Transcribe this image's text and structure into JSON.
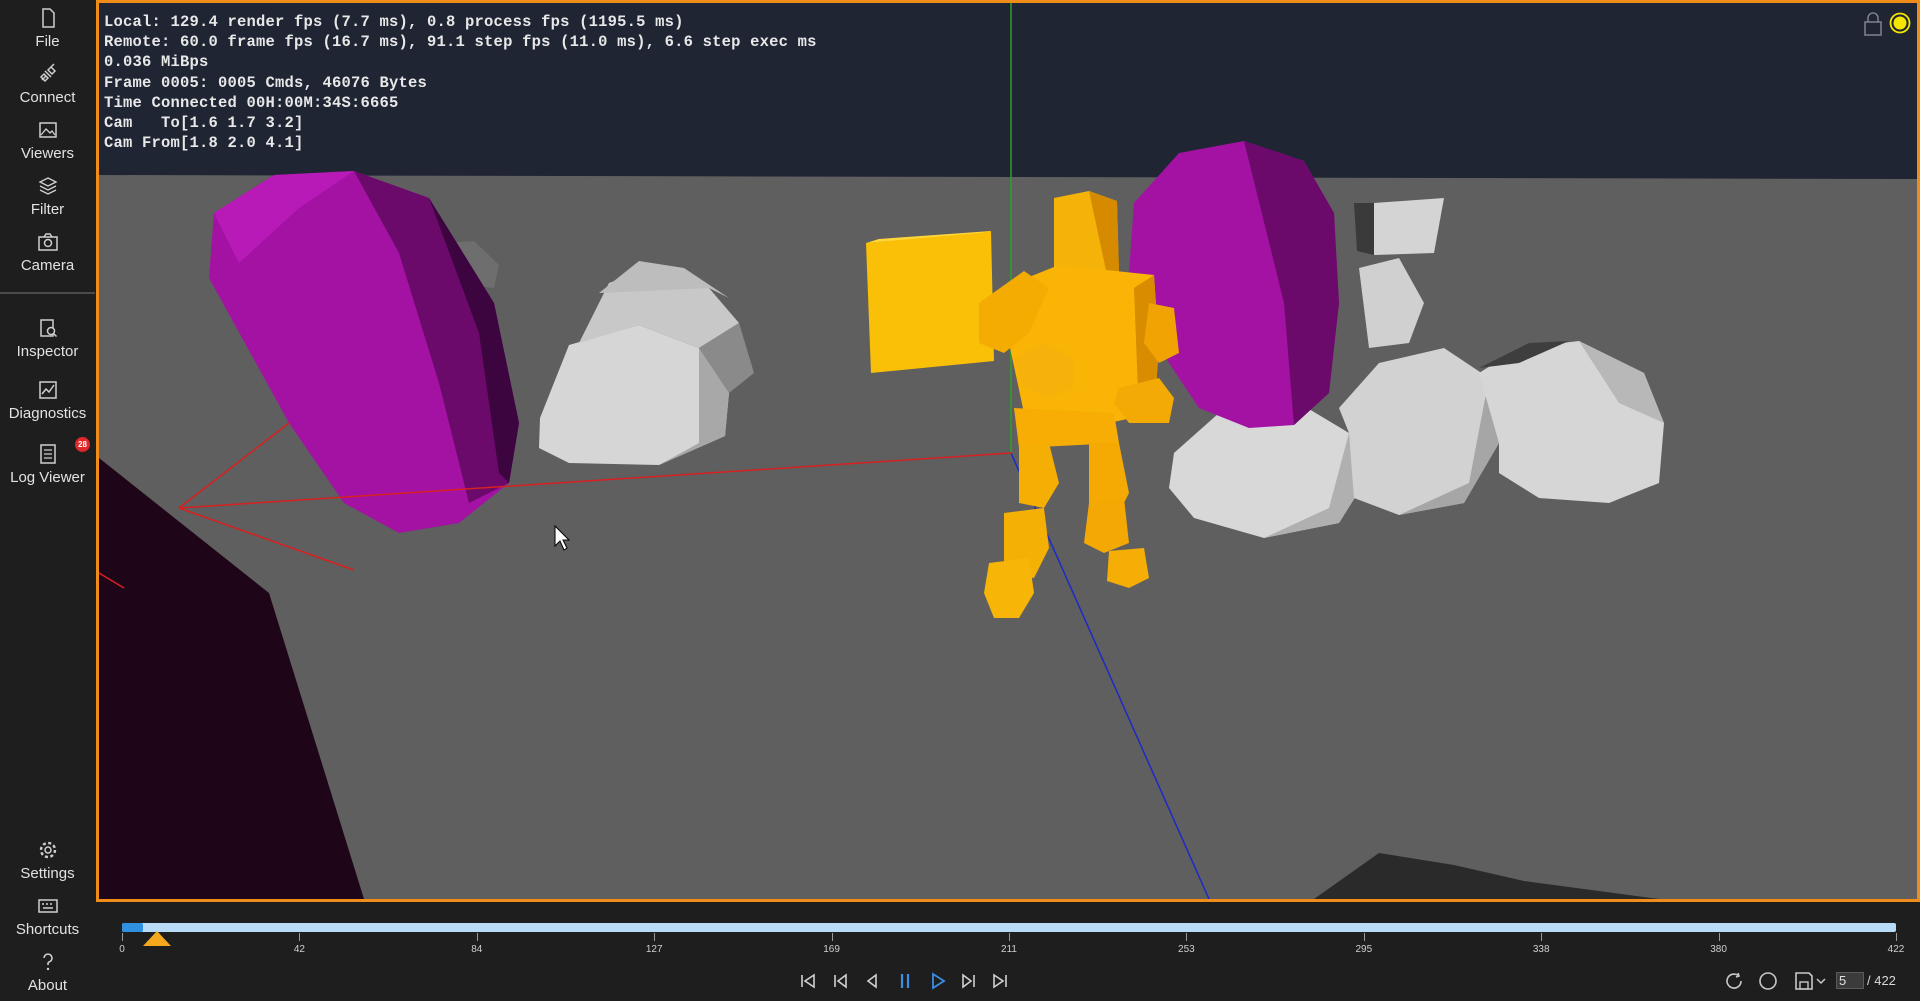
{
  "sidebar": {
    "items": [
      {
        "label": "File",
        "icon": "file-icon"
      },
      {
        "label": "Connect",
        "icon": "connect-icon"
      },
      {
        "label": "Viewers",
        "icon": "viewers-icon"
      },
      {
        "label": "Filter",
        "icon": "filter-icon"
      },
      {
        "label": "Camera",
        "icon": "camera-icon"
      },
      {
        "label": "Inspector",
        "icon": "inspector-icon"
      },
      {
        "label": "Diagnostics",
        "icon": "diagnostics-icon"
      },
      {
        "label": "Log Viewer",
        "icon": "log-icon"
      },
      {
        "label": "Settings",
        "icon": "gear-icon"
      },
      {
        "label": "Shortcuts",
        "icon": "keyboard-icon"
      },
      {
        "label": "About",
        "icon": "question-icon"
      }
    ],
    "log_badge": "28"
  },
  "stats": {
    "line1": "Local: 129.4 render fps (7.7 ms), 0.8 process fps (1195.5 ms)",
    "line2": "Remote: 60.0 frame fps (16.7 ms), 91.1 step fps (11.0 ms), 6.6 step exec ms",
    "line3": "0.036 MiBps",
    "line4": "Frame 0005: 0005 Cmds, 46076 Bytes",
    "line5": "Time Connected 00H:00M:34S:6665",
    "line6": "Cam   To[1.6 1.7 3.2]",
    "line7": "Cam From[1.8 2.0 4.1]"
  },
  "colors": {
    "accent": "#f08c1a",
    "status": "#f5e600",
    "track": "#b8dcf7",
    "track_fill": "#2f8fe0",
    "playhead": "#f5a81e"
  },
  "timeline": {
    "ticks": [
      "0",
      "42",
      "84",
      "127",
      "169",
      "211",
      "253",
      "295",
      "338",
      "380",
      "422"
    ],
    "current_frame": "5",
    "total_frames": "/ 422",
    "progress": 0.012
  },
  "playback": {
    "buttons": [
      "skip-to-start",
      "step-back-key",
      "step-back",
      "pause",
      "play",
      "step-forward",
      "skip-to-end"
    ]
  }
}
